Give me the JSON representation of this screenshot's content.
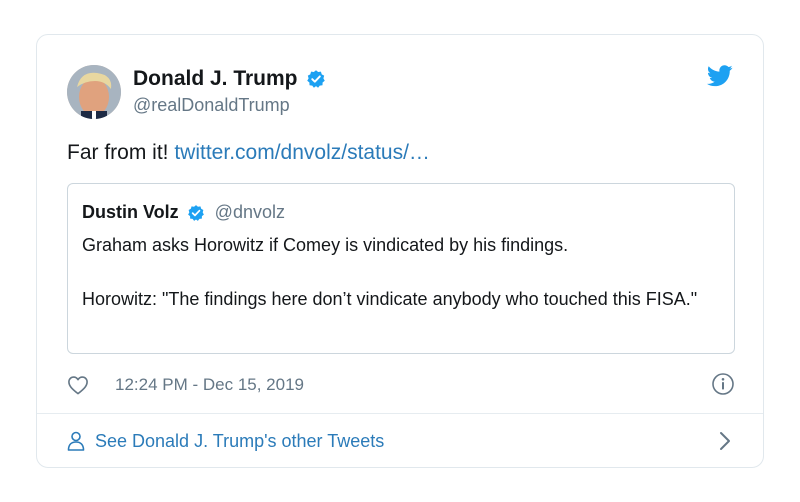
{
  "author": {
    "display_name": "Donald J. Trump",
    "handle": "@realDonaldTrump",
    "verified": true
  },
  "tweet": {
    "text": "Far from it! ",
    "link_text": "twitter.com/dnvolz/status/…"
  },
  "quoted_tweet": {
    "display_name": "Dustin Volz",
    "handle": "@dnvolz",
    "verified": true,
    "body": "Graham asks Horowitz if Comey is vindicated by his findings.\n\nHorowitz: \"The findings here don’t vindicate anybody who touched this FISA.\""
  },
  "meta": {
    "timestamp": "12:24 PM - Dec 15, 2019"
  },
  "footer": {
    "link_label": "See Donald J. Trump's other Tweets"
  },
  "colors": {
    "link": "#2b7bb9",
    "verified": "#1da1f2",
    "twitter_brand": "#1da1f2",
    "muted": "#657786"
  },
  "icons": [
    "twitter-bird-icon",
    "verified-badge-icon",
    "heart-icon",
    "info-icon",
    "person-icon",
    "chevron-right-icon"
  ]
}
